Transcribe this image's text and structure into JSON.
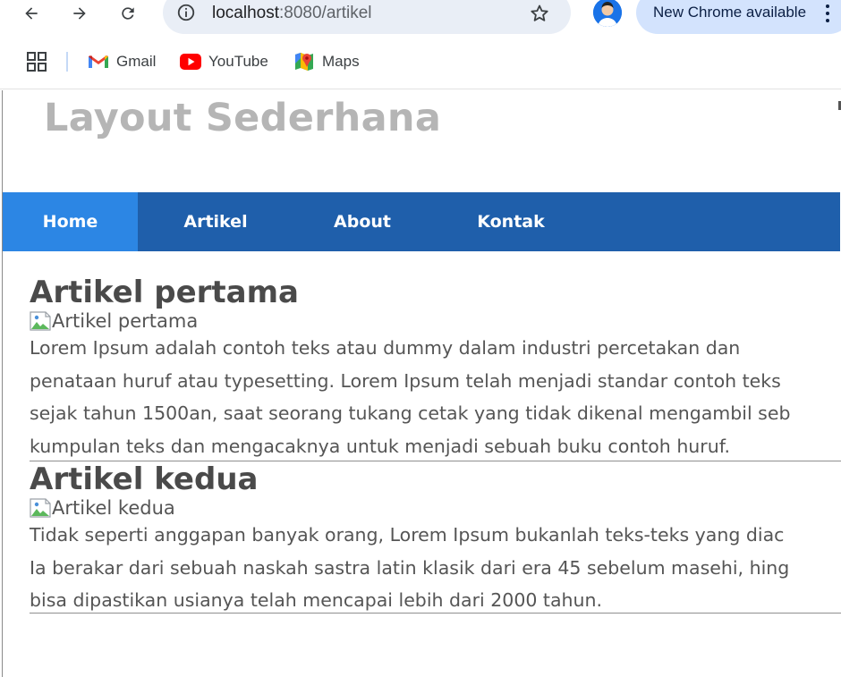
{
  "browser": {
    "url_host": "localhost",
    "url_rest": ":8080/artikel",
    "update_label": "New Chrome available",
    "bookmarks": [
      {
        "label": "Gmail"
      },
      {
        "label": "YouTube"
      },
      {
        "label": "Maps"
      }
    ]
  },
  "site": {
    "title": "Layout Sederhana",
    "menu": [
      {
        "label": "Home",
        "active": true
      },
      {
        "label": "Artikel",
        "active": false
      },
      {
        "label": "About",
        "active": false
      },
      {
        "label": "Kontak",
        "active": false
      }
    ]
  },
  "articles": [
    {
      "title": "Artikel pertama",
      "image_alt": "Artikel pertama",
      "lines": [
        "Lorem Ipsum adalah contoh teks atau dummy dalam industri percetakan dan",
        "penataan huruf atau typesetting. Lorem Ipsum telah menjadi standar contoh teks",
        "sejak tahun 1500an, saat seorang tukang cetak yang tidak dikenal mengambil seb",
        "kumpulan teks dan mengacaknya untuk menjadi sebuah buku contoh huruf."
      ]
    },
    {
      "title": "Artikel kedua",
      "image_alt": "Artikel kedua",
      "lines": [
        "Tidak seperti anggapan banyak orang, Lorem Ipsum bukanlah teks-teks yang diac",
        "Ia berakar dari sebuah naskah sastra latin klasik dari era 45 sebelum masehi, hing",
        "bisa dipastikan usianya telah mencapai lebih dari 2000 tahun."
      ]
    }
  ],
  "colors": {
    "nav_bg": "#1f5fab",
    "nav_active": "#2c86e4",
    "title": "#b5b5b5",
    "text": "#555555"
  }
}
